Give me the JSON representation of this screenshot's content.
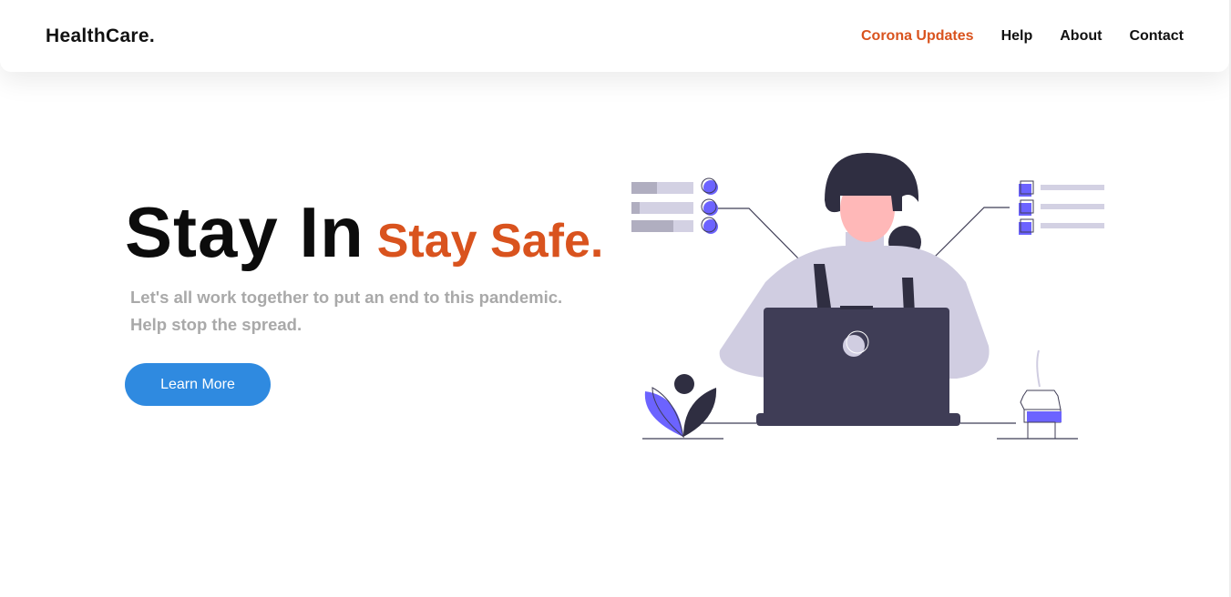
{
  "navbar": {
    "brand": "HealthCare.",
    "links": [
      {
        "label": "Corona Updates",
        "active": true
      },
      {
        "label": "Help",
        "active": false
      },
      {
        "label": "About",
        "active": false
      },
      {
        "label": "Contact",
        "active": false
      }
    ]
  },
  "hero": {
    "title_main": "Stay In",
    "title_accent": "Stay Safe.",
    "subtitle_line1": "Let's all work together to put an end to this pandemic.",
    "subtitle_line2": "Help stop the spread.",
    "cta_label": "Learn More"
  },
  "colors": {
    "accent": "#d9531e",
    "button": "#2f8ae0",
    "illustration_purple": "#6c63ff",
    "illustration_dark": "#3f3d56"
  },
  "illustration": {
    "icon": "woman-at-laptop-illustration"
  }
}
